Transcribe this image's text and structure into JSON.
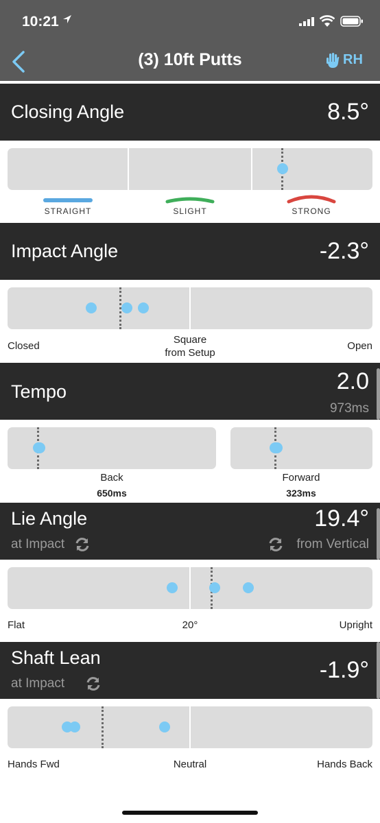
{
  "status": {
    "time": "10:21"
  },
  "nav": {
    "title": "(3) 10ft Putts",
    "handedness": "RH"
  },
  "closing_angle": {
    "title": "Closing Angle",
    "value": "8.5°",
    "zones": [
      {
        "label": "STRAIGHT",
        "color": "#5aa8e0"
      },
      {
        "label": "SLIGHT",
        "color": "#3fae5a"
      },
      {
        "label": "STRONG",
        "color": "#d9463f"
      }
    ]
  },
  "impact_angle": {
    "title": "Impact Angle",
    "value": "-2.3°",
    "left_label": "Closed",
    "center_label_line1": "Square",
    "center_label_line2": "from Setup",
    "right_label": "Open"
  },
  "tempo": {
    "title": "Tempo",
    "value": "2.0",
    "sub_value": "973ms",
    "back_label": "Back",
    "back_value": "650ms",
    "forward_label": "Forward",
    "forward_value": "323ms"
  },
  "lie_angle": {
    "title": "Lie Angle",
    "value": "19.4°",
    "sub_left": "at Impact",
    "sub_right": "from Vertical",
    "left_label": "Flat",
    "center_label": "20°",
    "right_label": "Upright"
  },
  "shaft_lean": {
    "title": "Shaft Lean",
    "value": "-1.9°",
    "sub_left": "at Impact",
    "left_label": "Hands Fwd",
    "center_label": "Neutral",
    "right_label": "Hands Back"
  },
  "colors": {
    "dot": "#7ccaf4",
    "header_bg": "#2a2a2a",
    "nav_bg": "#5a5a5a",
    "track": "#dcdcdc"
  }
}
